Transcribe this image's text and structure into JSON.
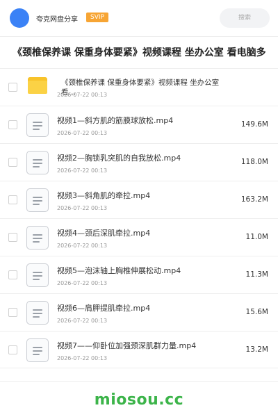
{
  "header": {
    "share_name": "夸克网盘分享",
    "svip": "SVIP",
    "search_placeholder": "搜索",
    "accent": "#3b82f6",
    "svip_color": "#f7a534"
  },
  "page_title": "《颈椎保养课 保重身体要紧》视频课程 坐办公室 看电脑多",
  "files": [
    {
      "type": "folder",
      "icon": "folder-icon",
      "name": "《颈椎保养课 保重身体要紧》视频课程 坐办公室 看…",
      "date": "2026-07-22 00:13",
      "size": ""
    },
    {
      "type": "file",
      "icon": "document-icon",
      "name": "视频1—斜方肌的筋膜球放松.mp4",
      "date": "2026-07-22 00:13",
      "size": "149.6M"
    },
    {
      "type": "file",
      "icon": "document-icon",
      "name": "视频2—胸锁乳突肌的自我放松.mp4",
      "date": "2026-07-22 00:13",
      "size": "118.0M"
    },
    {
      "type": "file",
      "icon": "document-icon",
      "name": "视频3—斜角肌的牵拉.mp4",
      "date": "2026-07-22 00:13",
      "size": "163.2M"
    },
    {
      "type": "file",
      "icon": "document-icon",
      "name": "视频4—颈后深肌牵拉.mp4",
      "date": "2026-07-22 00:13",
      "size": "11.0M"
    },
    {
      "type": "file",
      "icon": "document-icon",
      "name": "视频5—泡沫轴上胸椎伸展松动.mp4",
      "date": "2026-07-22 00:13",
      "size": "11.3M"
    },
    {
      "type": "file",
      "icon": "document-icon",
      "name": "视频6—肩胛提肌牵拉.mp4",
      "date": "2026-07-22 00:13",
      "size": "15.6M"
    },
    {
      "type": "file",
      "icon": "document-icon",
      "name": "视频7——仰卧位加强颈深肌群力量.mp4",
      "date": "2026-07-22 00:13",
      "size": "13.2M"
    }
  ],
  "footer": {
    "logo": "miosou.cc",
    "logo_color": "#3cb44a"
  }
}
